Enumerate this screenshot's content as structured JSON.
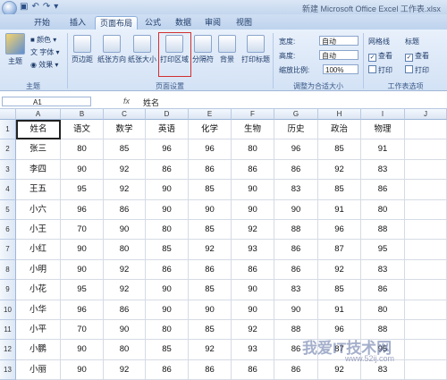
{
  "window": {
    "title": "新建 Microsoft Office Excel 工作表.xlsx"
  },
  "tabs": [
    "开始",
    "插入",
    "页面布局",
    "公式",
    "数据",
    "审阅",
    "视图"
  ],
  "ribbon": {
    "theme": {
      "button": "主题",
      "colors": "颜色",
      "fonts": "字体",
      "effects": "效果",
      "group": "主题"
    },
    "page_setup": {
      "margins": "页边距",
      "orientation": "纸张方向",
      "size": "纸张大小",
      "print_area": "打印区域",
      "breaks": "分隔符",
      "background": "背景",
      "print_titles": "打印标题",
      "group": "页面设置"
    },
    "scale": {
      "width_label": "宽度:",
      "width_value": "自动",
      "height_label": "高度:",
      "height_value": "自动",
      "scale_label": "缩放比例:",
      "scale_value": "100%",
      "group": "调整为合适大小"
    },
    "sheet_options": {
      "gridlines": "网格线",
      "headings": "标题",
      "view": "查看",
      "print": "打印",
      "group": "工作表选项"
    }
  },
  "formula_bar": {
    "name_box": "A1",
    "fx": "fx",
    "content": "姓名"
  },
  "columns": [
    "A",
    "B",
    "C",
    "D",
    "E",
    "F",
    "G",
    "H",
    "I",
    "J"
  ],
  "rows": [
    [
      "姓名",
      "语文",
      "数学",
      "英语",
      "化学",
      "生物",
      "历史",
      "政治",
      "物理"
    ],
    [
      "张三",
      "80",
      "85",
      "96",
      "96",
      "80",
      "96",
      "85",
      "91"
    ],
    [
      "李四",
      "90",
      "92",
      "86",
      "86",
      "86",
      "86",
      "92",
      "83"
    ],
    [
      "王五",
      "95",
      "92",
      "90",
      "85",
      "90",
      "83",
      "85",
      "86"
    ],
    [
      "小六",
      "96",
      "86",
      "90",
      "90",
      "90",
      "90",
      "91",
      "80"
    ],
    [
      "小王",
      "70",
      "90",
      "80",
      "85",
      "92",
      "88",
      "96",
      "88"
    ],
    [
      "小红",
      "90",
      "80",
      "85",
      "92",
      "93",
      "86",
      "87",
      "95"
    ],
    [
      "小明",
      "90",
      "92",
      "86",
      "86",
      "86",
      "86",
      "92",
      "83"
    ],
    [
      "小花",
      "95",
      "92",
      "90",
      "85",
      "90",
      "83",
      "85",
      "86"
    ],
    [
      "小华",
      "96",
      "86",
      "90",
      "90",
      "90",
      "90",
      "91",
      "80"
    ],
    [
      "小平",
      "70",
      "90",
      "80",
      "85",
      "92",
      "88",
      "96",
      "88"
    ],
    [
      "小鹏",
      "90",
      "80",
      "85",
      "92",
      "93",
      "86",
      "87",
      "95"
    ],
    [
      "小丽",
      "90",
      "92",
      "86",
      "86",
      "86",
      "86",
      "92",
      "83"
    ]
  ],
  "watermark": {
    "line1": "我爱IT技术网",
    "line2": "www.52ij.com"
  }
}
